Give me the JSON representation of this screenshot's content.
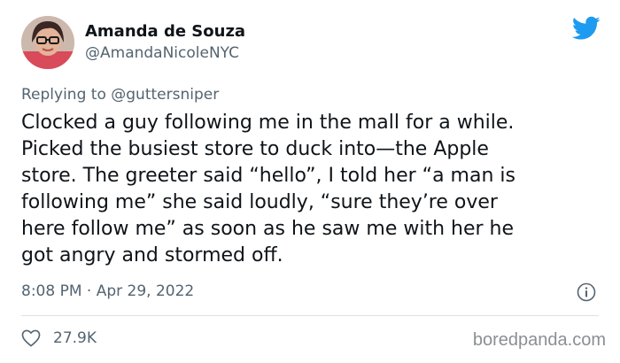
{
  "tweet": {
    "author": {
      "display_name": "Amanda de Souza",
      "handle": "@AmandaNicoleNYC",
      "avatar_icon": "profile-photo-avatar"
    },
    "reply": {
      "prefix": "Replying to ",
      "mention": "@guttersniper"
    },
    "text": "Clocked a guy following me in the mall for a while.\nPicked the busiest store to duck into—the Apple\nstore. The greeter said “hello”, I told her “a man is\nfollowing me” she said loudly, “sure they’re over\nhere follow me” as soon as he saw me with her he\ngot angry and stormed off.",
    "timestamp": "8:08 PM · Apr 29, 2022",
    "likes": "27.9K",
    "icons": {
      "brand": "twitter-bird-icon",
      "info": "info-icon",
      "like": "heart-icon"
    }
  },
  "watermark": "boredpanda.com",
  "colors": {
    "brand_blue": "#1d9bf0",
    "text_primary": "#0f1419",
    "text_secondary": "#536471",
    "divider": "#dbe2e7"
  }
}
